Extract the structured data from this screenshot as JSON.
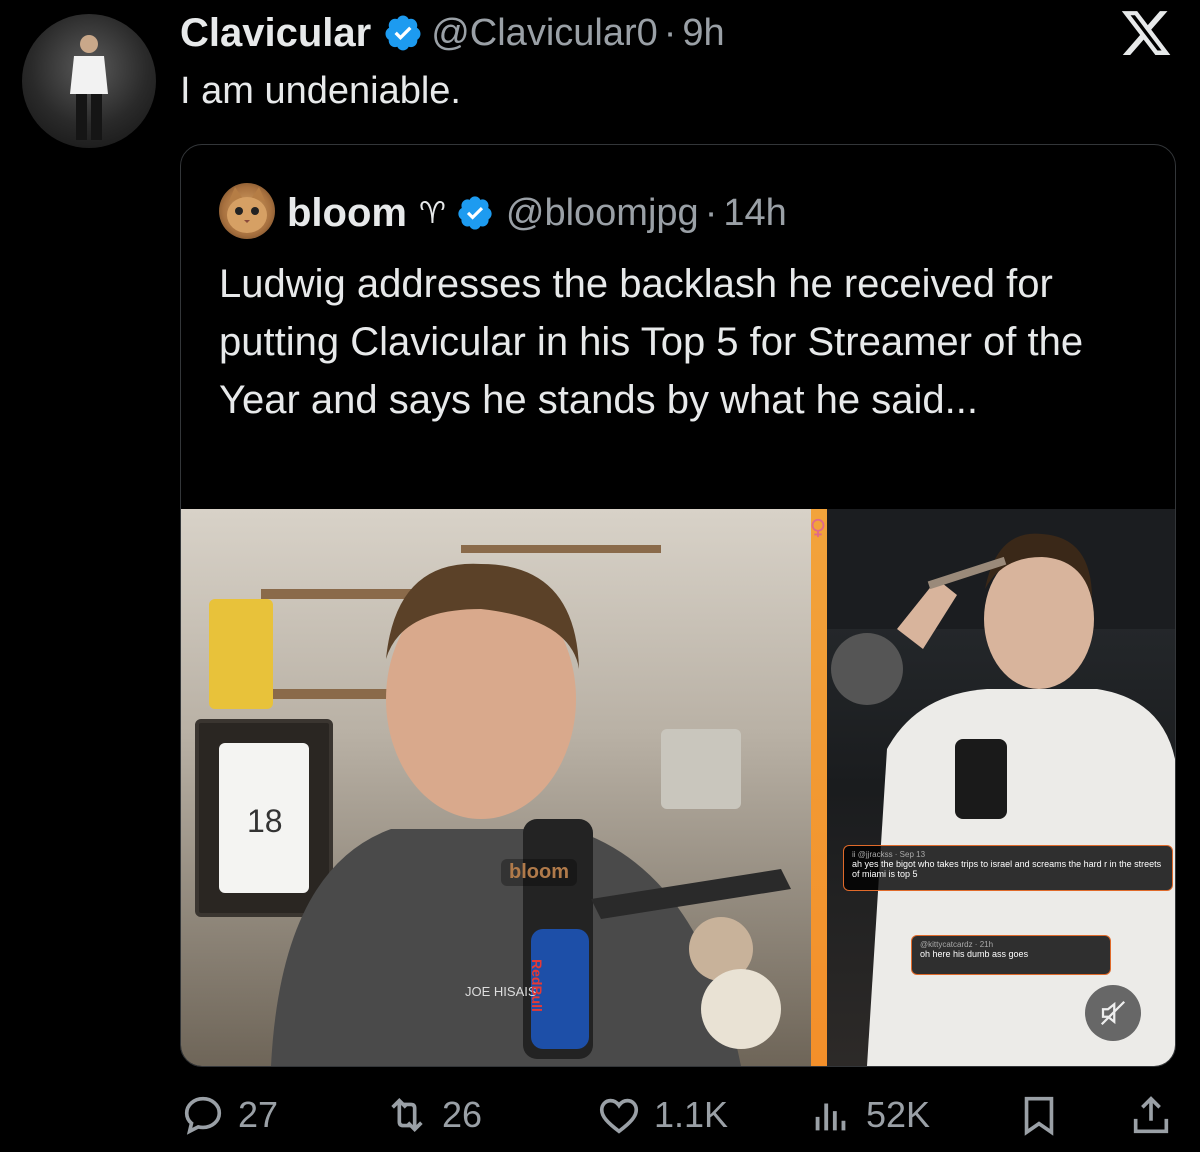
{
  "tweet": {
    "author": {
      "display_name": "Clavicular",
      "handle": "@Clavicular0",
      "time": "9h"
    },
    "separator": "·",
    "text": "I am undeniable."
  },
  "quote": {
    "author": {
      "display_name": "bloom",
      "symbol": "♈",
      "handle": "@bloomjpg",
      "time": "14h"
    },
    "separator": "·",
    "text": "Ludwig addresses the backlash he received for putting Clavicular in his Top 5 for Streamer of the Year and says he stands by what he said...",
    "media": {
      "watermark": "bloom",
      "shirt_text": "JOE HISAIS",
      "can_text": "RedBull",
      "jersey_number": "18",
      "embed_1": {
        "meta": "ii @jjrackss · Sep 13",
        "text": "ah yes the bigot who takes trips to israel and screams the hard r in the streets of miami is top 5"
      },
      "embed_2": {
        "meta": "@kittycatcardz · 21h",
        "text": "oh here his dumb ass goes"
      }
    }
  },
  "actions": {
    "replies": "27",
    "reposts": "26",
    "likes": "1.1K",
    "views": "52K"
  },
  "colors": {
    "verified": "#1d9bf0",
    "divider": "#f2a33b",
    "muted": "#9aa0a6"
  }
}
